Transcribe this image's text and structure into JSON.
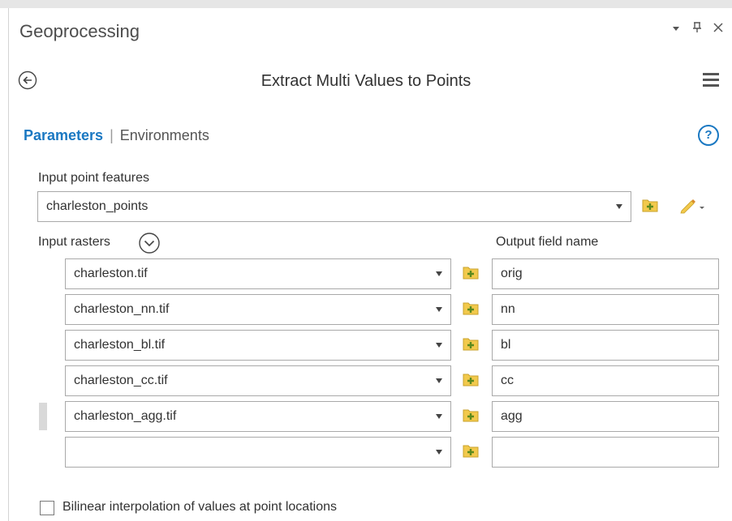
{
  "pane": {
    "title": "Geoprocessing",
    "controls": [
      "dropdown-arrow",
      "pin",
      "close"
    ]
  },
  "tool": {
    "title": "Extract Multi Values to Points"
  },
  "tabs": {
    "parameters": "Parameters",
    "separator": "|",
    "environments": "Environments",
    "help_glyph": "?"
  },
  "input_point_features": {
    "label": "Input point features",
    "value": "charleston_points"
  },
  "input_rasters": {
    "label": "Input rasters",
    "output_label": "Output field name",
    "rows": [
      {
        "raster": "charleston.tif",
        "field": "orig"
      },
      {
        "raster": "charleston_nn.tif",
        "field": "nn"
      },
      {
        "raster": "charleston_bl.tif",
        "field": "bl"
      },
      {
        "raster": "charleston_cc.tif",
        "field": "cc"
      },
      {
        "raster": "charleston_agg.tif",
        "field": "agg"
      },
      {
        "raster": "",
        "field": ""
      }
    ]
  },
  "bilinear": {
    "label": "Bilinear interpolation of values at point locations",
    "checked": false
  },
  "colors": {
    "accent": "#1a78c2",
    "folder": "#f2c94c",
    "plus": "#5c8a1e"
  }
}
